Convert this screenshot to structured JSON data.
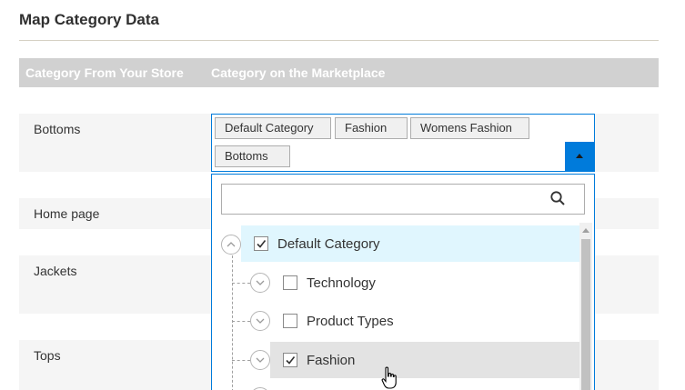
{
  "section": {
    "title": "Map Category Data"
  },
  "table": {
    "header_store": "Category From Your Store",
    "header_marketplace": "Category on the Marketplace",
    "rows": [
      "Bottoms",
      "Home page",
      "Jackets",
      "Tops"
    ]
  },
  "multiselect": {
    "chips": [
      "Default Category",
      "Fashion",
      "Womens Fashion",
      "Bottoms"
    ]
  },
  "dropdown": {
    "search_value": "",
    "tree": [
      {
        "label": "Default Category",
        "checked": true,
        "expanded": true,
        "state": "active"
      },
      {
        "label": "Technology",
        "checked": false,
        "expanded": false,
        "state": "normal"
      },
      {
        "label": "Product Types",
        "checked": false,
        "expanded": false,
        "state": "normal"
      },
      {
        "label": "Fashion",
        "checked": true,
        "expanded": false,
        "state": "hover"
      }
    ]
  },
  "colors": {
    "accent": "#007bdb",
    "header_bg": "#d1d1d1",
    "row_bg": "#f5f5f5",
    "active_node_bg": "#e0f6fe",
    "hover_node_bg": "#e3e3e3"
  },
  "icons": {
    "search": "search-icon",
    "toggle": "triangle-up-icon",
    "collapse": "chevron-up-circle-icon",
    "expand": "chevron-down-circle-icon",
    "check": "checkmark-icon",
    "cursor": "hand-pointer-icon"
  }
}
